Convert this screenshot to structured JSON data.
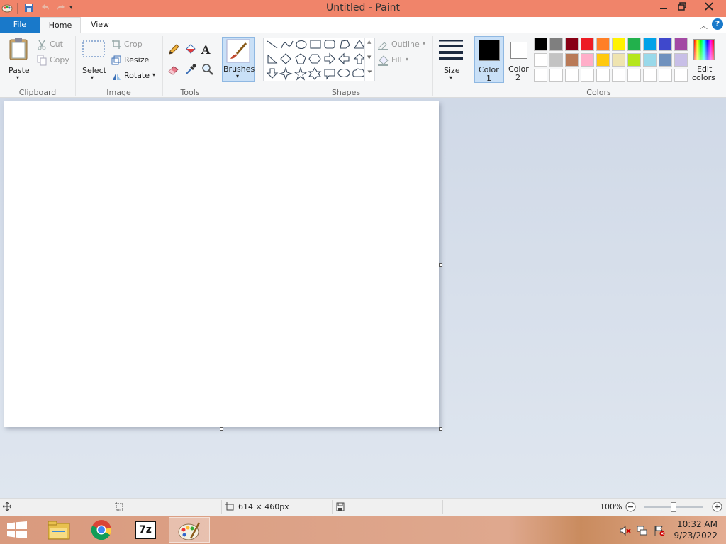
{
  "window": {
    "title": "Untitled - Paint"
  },
  "tabs": {
    "file": "File",
    "home": "Home",
    "view": "View"
  },
  "help_icon": "?",
  "clipboard": {
    "paste": "Paste",
    "cut": "Cut",
    "copy": "Copy",
    "label": "Clipboard"
  },
  "image": {
    "select": "Select",
    "crop": "Crop",
    "resize": "Resize",
    "rotate": "Rotate",
    "label": "Image"
  },
  "tools": {
    "label": "Tools",
    "text_tool": "A"
  },
  "brushes": {
    "label": "Brushes"
  },
  "shapes": {
    "outline": "Outline",
    "fill": "Fill",
    "label": "Shapes"
  },
  "size": {
    "label": "Size"
  },
  "color1": {
    "line1": "Color",
    "line2": "1",
    "value": "#000000"
  },
  "color2": {
    "line1": "Color",
    "line2": "2",
    "value": "#ffffff"
  },
  "colors": {
    "label": "Colors",
    "edit_line1": "Edit",
    "edit_line2": "colors",
    "palette_row1": [
      "#000000",
      "#7f7f7f",
      "#880015",
      "#ed1c24",
      "#ff7f27",
      "#fff200",
      "#22b14c",
      "#00a2e8",
      "#3f48cc",
      "#a349a4"
    ],
    "palette_row2": [
      "#ffffff",
      "#c3c3c3",
      "#b97a57",
      "#ffaec9",
      "#ffc90e",
      "#efe4b0",
      "#b5e61d",
      "#99d9ea",
      "#7092be",
      "#c8bfe7"
    ],
    "palette_row3": [
      "#ffffff",
      "#ffffff",
      "#ffffff",
      "#ffffff",
      "#ffffff",
      "#ffffff",
      "#ffffff",
      "#ffffff",
      "#ffffff",
      "#ffffff"
    ]
  },
  "status": {
    "dimensions": "614 × 460px",
    "zoom": "100%"
  },
  "taskbar": {
    "time": "10:32 AM",
    "date": "9/23/2022",
    "sevenzip": "7z"
  }
}
